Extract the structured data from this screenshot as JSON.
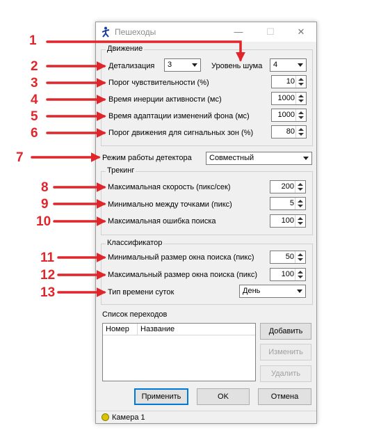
{
  "window": {
    "title": "Пешеходы",
    "titlebar_buttons": [
      "—",
      "☐",
      "✕"
    ]
  },
  "motion": {
    "group_label": "Движение",
    "detail_label": "Детализация",
    "detail_value": "3",
    "noise_label": "Уровень шума",
    "noise_value": "4",
    "sensitivity_label": "Порог чувствительности (%)",
    "sensitivity_value": "10",
    "inertia_label": "Время инерции активности (мс)",
    "inertia_value": "1000",
    "adaptation_label": "Время адаптации изменений фона (мс)",
    "adaptation_value": "1000",
    "signal_zones_label": "Порог движения для сигнальных зон (%)",
    "signal_zones_value": "80"
  },
  "detector_mode": {
    "label": "Режим работы детектора",
    "value": "Совместный"
  },
  "tracking": {
    "group_label": "Трекинг",
    "max_speed_label": "Максимальная скорость (пикс/сек)",
    "max_speed_value": "200",
    "min_between_label": "Минимально между точками (пикс)",
    "min_between_value": "5",
    "max_error_label": "Максимальная ошибка поиска",
    "max_error_value": "100"
  },
  "classifier": {
    "group_label": "Классификатор",
    "min_window_label": "Минимальный размер окна поиска (пикс)",
    "min_window_value": "50",
    "max_window_label": "Максимальный размер окна поиска (пикс)",
    "max_window_value": "100",
    "time_of_day_label": "Тип времени суток",
    "time_of_day_value": "День"
  },
  "transitions": {
    "label": "Список переходов",
    "columns": [
      "Номер",
      "Название"
    ],
    "add_button": "Добавить",
    "edit_button": "Изменить",
    "delete_button": "Удалить"
  },
  "footer": {
    "apply_button": "Применить",
    "ok_button": "OK",
    "cancel_button": "Отмена"
  },
  "status_bar": {
    "camera_label": "Камера 1"
  },
  "annotations": [
    "1",
    "2",
    "3",
    "4",
    "5",
    "6",
    "7",
    "8",
    "9",
    "10",
    "11",
    "12",
    "13"
  ],
  "colors": {
    "annotation": "#e0262b",
    "accent": "#0078d7"
  }
}
